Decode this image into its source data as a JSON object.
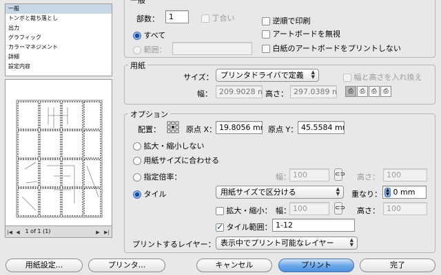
{
  "sidebar": {
    "items": [
      "一般",
      "トンボと裁ち落とし",
      "出力",
      "グラフィック",
      "カラーマネジメント",
      "詳細",
      "設定内容"
    ],
    "selected_index": 0
  },
  "preview": {
    "page_label": "1 of 1 (1)"
  },
  "general": {
    "title": "一般",
    "copies_label": "部数：",
    "copies_value": "1",
    "collate_label": "丁合い",
    "reverse_label": "逆順で印刷",
    "ignore_artboards_label": "アートボードを無視",
    "skip_blank_label": "白紙のアートボードをプリントしない",
    "all_label": "すべて",
    "range_label": "範囲："
  },
  "paper": {
    "title": "用紙",
    "size_label": "サイズ：",
    "size_value": "プリンタドライバで定義",
    "swap_label": "幅と高さを入れ換え",
    "width_label": "幅：",
    "width_value": "209.9028 m",
    "height_label": "高さ：",
    "height_value": "297.0389 m"
  },
  "options": {
    "title": "オプション",
    "placement_label": "配置：",
    "origin_x_label": "原点 X：",
    "origin_x_value": "19.8056 mn",
    "origin_y_label": "原点 Y：",
    "origin_y_value": "45.5584 mn",
    "no_scale_label": "拡大・縮小しない",
    "fit_label": "用紙サイズに合わせる",
    "custom_scale_label": "指定倍率：",
    "width_label": "幅：",
    "width_value": "100",
    "height_label": "高さ：",
    "height_value": "100",
    "tile_label": "タイル",
    "tile_mode_value": "用紙サイズで区分ける",
    "overlap_label": "重なり：",
    "overlap_value": "0 mm",
    "scale_label": "拡大・縮小：",
    "scale_width_label": "幅：",
    "scale_width_value": "100",
    "scale_height_label": "高さ：",
    "scale_height_value": "100",
    "tile_range_label": "タイル範囲：",
    "tile_range_value": "1-12",
    "layers_label": "プリントするレイヤー：",
    "layers_value": "表示中でプリント可能なレイヤー"
  },
  "footer": {
    "page_setup": "用紙設定...",
    "printer": "プリンタ...",
    "cancel": "キャンセル",
    "print": "プリント",
    "done": "完了"
  }
}
